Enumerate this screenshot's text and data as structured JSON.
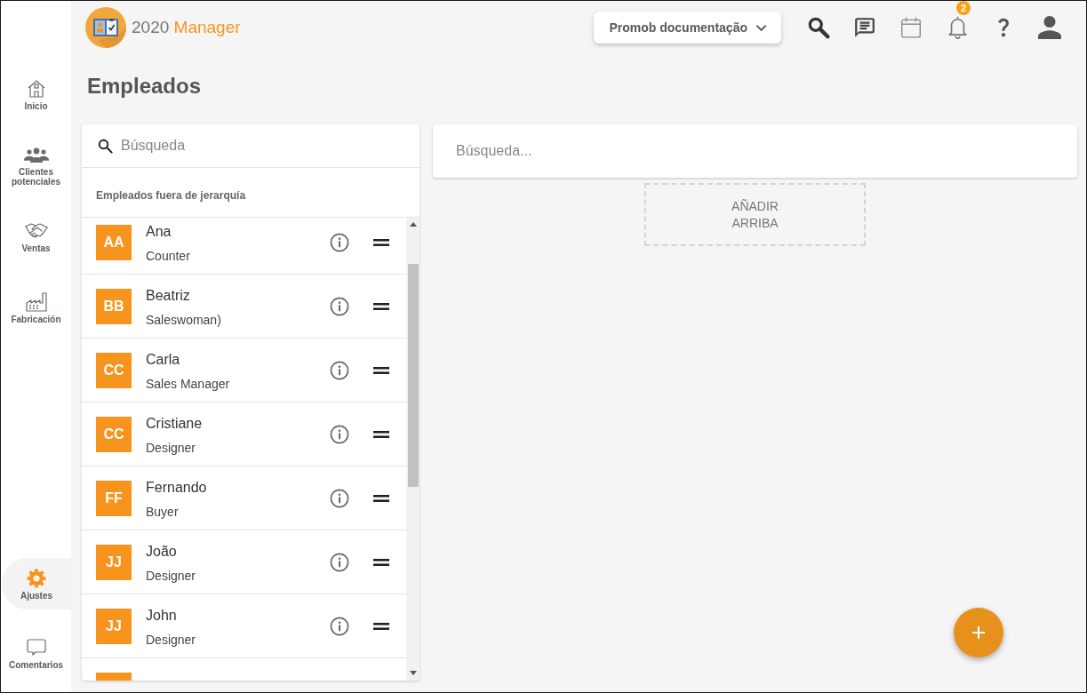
{
  "header": {
    "logo": {
      "number": "2020",
      "word": "Manager"
    },
    "workspace_dropdown": {
      "label": "Promob documentação"
    },
    "notifications_badge": "2"
  },
  "sidebar": {
    "items": [
      {
        "label": "Inicio",
        "selected": false
      },
      {
        "label": "Clientes potenciales",
        "selected": false
      },
      {
        "label": "Ventas",
        "selected": false
      },
      {
        "label": "Fabricación",
        "selected": false
      }
    ],
    "bottom_items": [
      {
        "label": "Ajustes",
        "selected": true
      },
      {
        "label": "Comentarios",
        "selected": false
      }
    ]
  },
  "page": {
    "title": "Empleados"
  },
  "employee_list": {
    "search": {
      "placeholder": "Búsqueda"
    },
    "section_title": "Empleados fuera de jerarquía",
    "employees": [
      {
        "initials": "AA",
        "name": "Ana",
        "role": "Counter"
      },
      {
        "initials": "BB",
        "name": "Beatriz",
        "role": "Saleswoman)"
      },
      {
        "initials": "CC",
        "name": "Carla",
        "role": "Sales Manager"
      },
      {
        "initials": "CC",
        "name": "Cristiane",
        "role": "Designer"
      },
      {
        "initials": "FF",
        "name": "Fernando",
        "role": "Buyer"
      },
      {
        "initials": "JJ",
        "name": "João",
        "role": "Designer"
      },
      {
        "initials": "JJ",
        "name": "John",
        "role": "Designer"
      }
    ],
    "partial_row_below": true
  },
  "hierarchy": {
    "search": {
      "placeholder": "Búsqueda..."
    },
    "add_above": "AÑADIR ARRIBA"
  }
}
